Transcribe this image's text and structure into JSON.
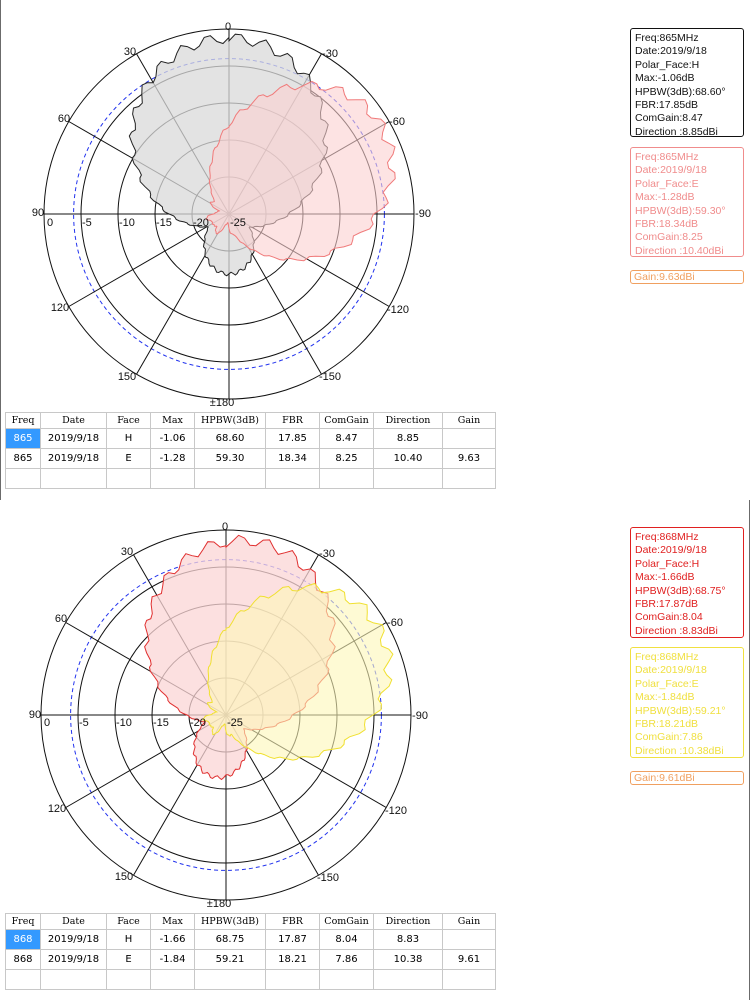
{
  "plots": [
    {
      "angle_labels": {
        "a0": "0",
        "a30": "30",
        "a330": "-30",
        "a60": "60",
        "a300": "-60",
        "a90": "90",
        "a270": "-90",
        "a120": "120",
        "a240": "-120",
        "a150": "150",
        "a210": "-150",
        "a180": "±180"
      },
      "radial_labels": [
        "0",
        "-5",
        "-10",
        "-15",
        "-20",
        "-25"
      ],
      "info_h": {
        "freq": "Freq:865MHz",
        "date": "Date:2019/9/18",
        "face": "Polar_Face:H",
        "max": "Max:-1.06dB",
        "hpbw": "HPBW(3dB):68.60°",
        "fbr": "FBR:17.85dB",
        "comgain": "ComGain:8.47",
        "direction": "Direction :8.85dBi"
      },
      "info_e": {
        "freq": "Freq:865MHz",
        "date": "Date:2019/9/18",
        "face": "Polar_Face:E",
        "max": "Max:-1.28dB",
        "hpbw": "HPBW(3dB):59.30°",
        "fbr": "FBR:18.34dB",
        "comgain": "ComGain:8.25",
        "direction": "Direction :10.40dBi"
      },
      "gain": "Gain:9.63dBi",
      "colors": {
        "h_stroke": "#222222",
        "h_fill": "#d9d9d9",
        "e_stroke": "#f07a7a",
        "e_fill": "#fbd0d0",
        "h_box": "#111111",
        "e_box": "#f08c8c",
        "gain_box": "#f0a060"
      },
      "table": {
        "headers": [
          "Freq",
          "Date",
          "Face",
          "Max",
          "HPBW(3dB)",
          "FBR",
          "ComGain",
          "Direction",
          "Gain"
        ],
        "rows": [
          [
            "865",
            "2019/9/18",
            "H",
            "-1.06",
            "68.60",
            "17.85",
            "8.47",
            "8.85",
            ""
          ],
          [
            "865",
            "2019/9/18",
            "E",
            "-1.28",
            "59.30",
            "18.34",
            "8.25",
            "10.40",
            "9.63"
          ]
        ]
      }
    },
    {
      "angle_labels": {
        "a0": "0",
        "a30": "30",
        "a330": "-30",
        "a60": "60",
        "a300": "-60",
        "a90": "90",
        "a270": "-90",
        "a120": "120",
        "a240": "-120",
        "a150": "150",
        "a210": "-150",
        "a180": "±180"
      },
      "radial_labels": [
        "0",
        "-5",
        "-10",
        "-15",
        "-20",
        "-25"
      ],
      "info_h": {
        "freq": "Freq:868MHz",
        "date": "Date:2019/9/18",
        "face": "Polar_Face:H",
        "max": "Max:-1.66dB",
        "hpbw": "HPBW(3dB):68.75°",
        "fbr": "FBR:17.87dB",
        "comgain": "ComGain:8.04",
        "direction": "Direction :8.83dBi"
      },
      "info_e": {
        "freq": "Freq:868MHz",
        "date": "Date:2019/9/18",
        "face": "Polar_Face:E",
        "max": "Max:-1.84dB",
        "hpbw": "HPBW(3dB):59.21°",
        "fbr": "FBR:18.21dB",
        "comgain": "ComGain:7.86",
        "direction": "Direction :10.38dBi"
      },
      "gain": "Gain:9.61dBi",
      "colors": {
        "h_stroke": "#e03030",
        "h_fill": "#fbd6d6",
        "e_stroke": "#f0e030",
        "e_fill": "#fdf7b8",
        "h_box": "#e02020",
        "e_box": "#f0e040",
        "gain_box": "#f0a060"
      },
      "table": {
        "headers": [
          "Freq",
          "Date",
          "Face",
          "Max",
          "HPBW(3dB)",
          "FBR",
          "ComGain",
          "Direction",
          "Gain"
        ],
        "rows": [
          [
            "868",
            "2019/9/18",
            "H",
            "-1.66",
            "68.75",
            "17.87",
            "8.04",
            "8.83",
            ""
          ],
          [
            "868",
            "2019/9/18",
            "E",
            "-1.84",
            "59.21",
            "18.21",
            "7.86",
            "10.38",
            "9.61"
          ]
        ]
      }
    }
  ]
}
